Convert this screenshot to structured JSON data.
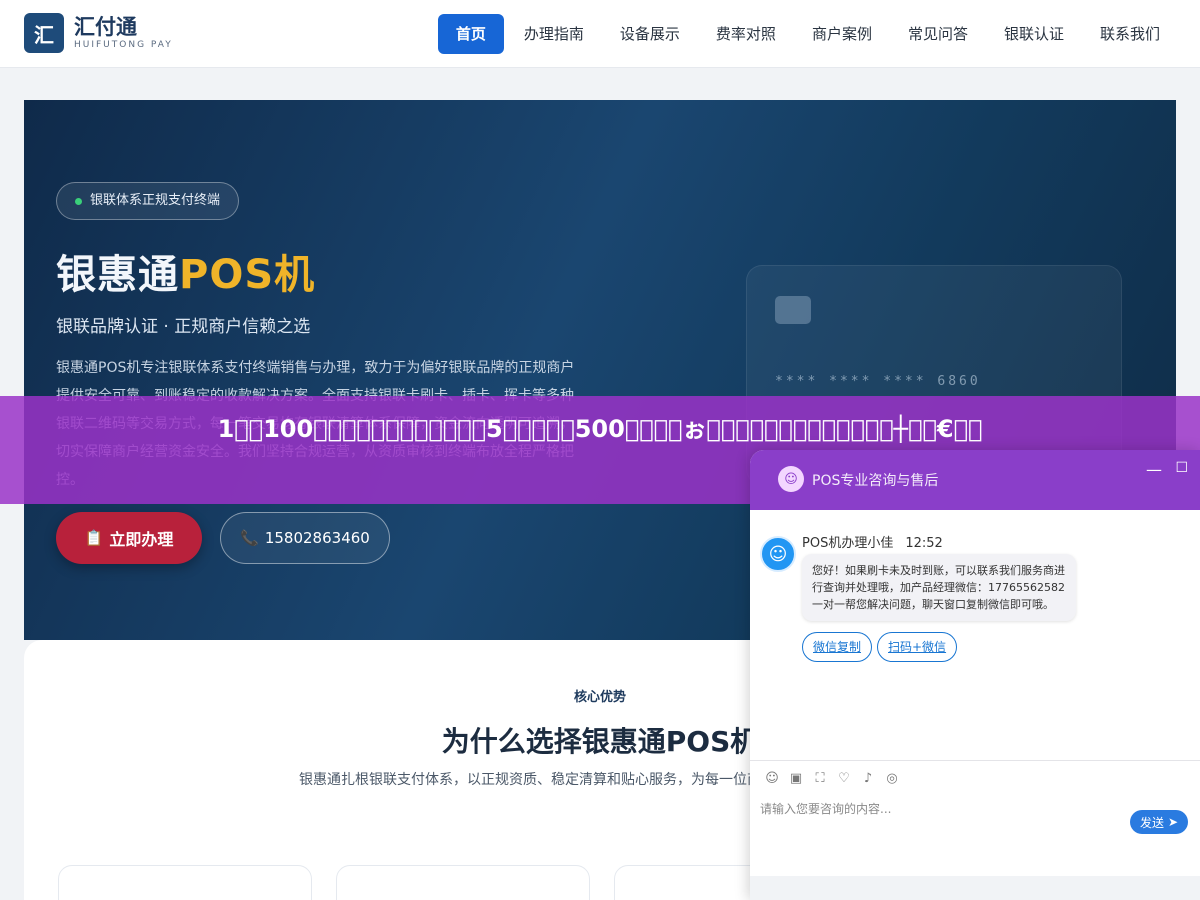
{
  "brand": {
    "mark": "汇",
    "name": "汇付通",
    "sub": "HUIFUTONG PAY"
  },
  "nav": [
    {
      "label": "首页"
    },
    {
      "label": "办理指南"
    },
    {
      "label": "设备展示"
    },
    {
      "label": "费率对照"
    },
    {
      "label": "商户案例"
    },
    {
      "label": "常见问答"
    },
    {
      "label": "银联认证"
    },
    {
      "label": "联系我们"
    }
  ],
  "hero": {
    "badge": "银联体系正规支付终端",
    "title_main": "银惠通",
    "title_highlight": "POS机",
    "subtitle": "银联品牌认证 · 正规商户信赖之选",
    "description": "银惠通POS机专注银联体系支付终端销售与办理，致力于为偏好银联品牌的正规商户提供安全可靠、到账稳定的收款解决方案。全面支持银联卡刷卡、插卡、挥卡等多种银联二维码等交易方式，每一笔交易均有银联清算体系保障，资金流向透明可追溯，切实保障商户经营资金安全。我们坚持合规运营，从资质审核到终端布放全程严格把控。",
    "apply_label": "立即办理",
    "phone": "15802863460",
    "card_number": "**** **** **** 6860"
  },
  "overlay": {
    "text": "1𰂂定100绮𰂂绷𰂂𰂂𰂂𰂂𰂂𰂂𰂂锛𰂂5𰂂𰂂涔颁𰂂500绮𰂂湑𰂂ぉ𰂂处𰂂疯𰂂𰂂浜𰂂𰂂𰂂𰂂繁韪┼𰂂浠€涔𰂂"
  },
  "section": {
    "tag": "核心优势",
    "title": "为什么选择银惠通POS机",
    "description": "银惠通扎根银联支付体系，以正规资质、稳定清算和贴心服务，为每一位商户提供放心收款终端。"
  },
  "chat": {
    "title": "POS专业咨询与售后",
    "agent_name": "POS机办理小佳",
    "time": "12:52",
    "message": "您好！如果刷卡未及时到账，可以联系我们服务商进行查询并处理哦，加产品经理微信：17765562582 一对一帮您解决问题，聊天窗口复制微信即可哦。",
    "quick_replies": [
      "微信复制",
      "扫码+微信"
    ],
    "input_placeholder": "请输入您要咨询的内容...",
    "send_label": "发送",
    "minimize": "—",
    "maximize": "☐"
  },
  "icons": {
    "apply": "clipboard-icon",
    "phone": "phone-icon",
    "accent": "#1766d6",
    "overlay_color": "#9a32c8"
  }
}
